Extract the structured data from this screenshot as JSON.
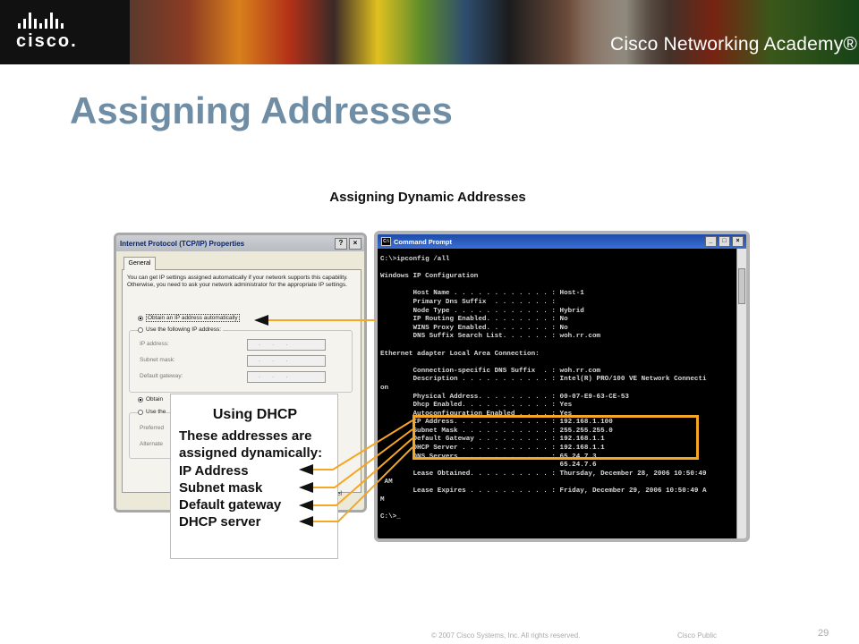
{
  "header": {
    "logo_text": "cisco.",
    "academy": "Cisco Networking Academy®"
  },
  "slide": {
    "title": "Assigning Addresses",
    "figure_title": "Assigning Dynamic Addresses"
  },
  "dialog": {
    "title": "Internet Protocol (TCP/IP) Properties",
    "help_btn": "?",
    "close_btn": "×",
    "tab": "General",
    "intro": "You can get IP settings assigned automatically if your network supports this capability. Otherwise, you need to ask your network administrator for the appropriate IP settings.",
    "radio_auto_ip": "Obtain an IP address automatically",
    "radio_manual_ip": "Use the following IP address:",
    "field_ip": "IP address:",
    "field_mask": "Subnet mask:",
    "field_gateway": "Default gateway:",
    "ip_placeholder": ". . .",
    "radio_auto_dns": "Obtain",
    "radio_manual_dns": "Use the",
    "field_pref": "Preferred",
    "field_alt": "Alternate",
    "cancel_partial": "cel"
  },
  "cmd": {
    "title": "Command Prompt",
    "lines": [
      "C:\\>ipconfig /all",
      "",
      "Windows IP Configuration",
      "",
      "        Host Name . . . . . . . . . . . . : Host-1",
      "        Primary Dns Suffix  . . . . . . . :",
      "        Node Type . . . . . . . . . . . . : Hybrid",
      "        IP Routing Enabled. . . . . . . . : No",
      "        WINS Proxy Enabled. . . . . . . . : No",
      "        DNS Suffix Search List. . . . . . : woh.rr.com",
      "",
      "Ethernet adapter Local Area Connection:",
      "",
      "        Connection-specific DNS Suffix  . : woh.rr.com",
      "        Description . . . . . . . . . . . : Intel(R) PRO/100 VE Network Connecti",
      "on",
      "        Physical Address. . . . . . . . . : 00-07-E9-63-CE-53",
      "        Dhcp Enabled. . . . . . . . . . . : Yes",
      "        Autoconfiguration Enabled . . . . : Yes",
      "        IP Address. . . . . . . . . . . . : 192.168.1.100",
      "        Subnet Mask . . . . . . . . . . . : 255.255.255.0",
      "        Default Gateway . . . . . . . . . : 192.168.1.1",
      "        DHCP Server . . . . . . . . . . . : 192.168.1.1",
      "        DNS Servers . . . . . . . . . . . : 65.24.7.3",
      "                                            65.24.7.6",
      "        Lease Obtained. . . . . . . . . . : Thursday, December 28, 2006 10:50:49",
      " AM",
      "        Lease Expires . . . . . . . . . . : Friday, December 29, 2006 10:50:49 A",
      "M",
      "",
      "C:\\>_"
    ]
  },
  "callout": {
    "heading": "Using DHCP",
    "desc": "These addresses are assigned dynamically:",
    "items": [
      "IP Address",
      "Subnet mask",
      "Default gateway",
      "DHCP server"
    ]
  },
  "footer": {
    "copyright": "© 2007 Cisco Systems, Inc. All rights reserved.",
    "classification": "Cisco Public",
    "page": "29"
  },
  "colors": {
    "title": "#6f8ea5",
    "highlight": "#f5a623"
  }
}
